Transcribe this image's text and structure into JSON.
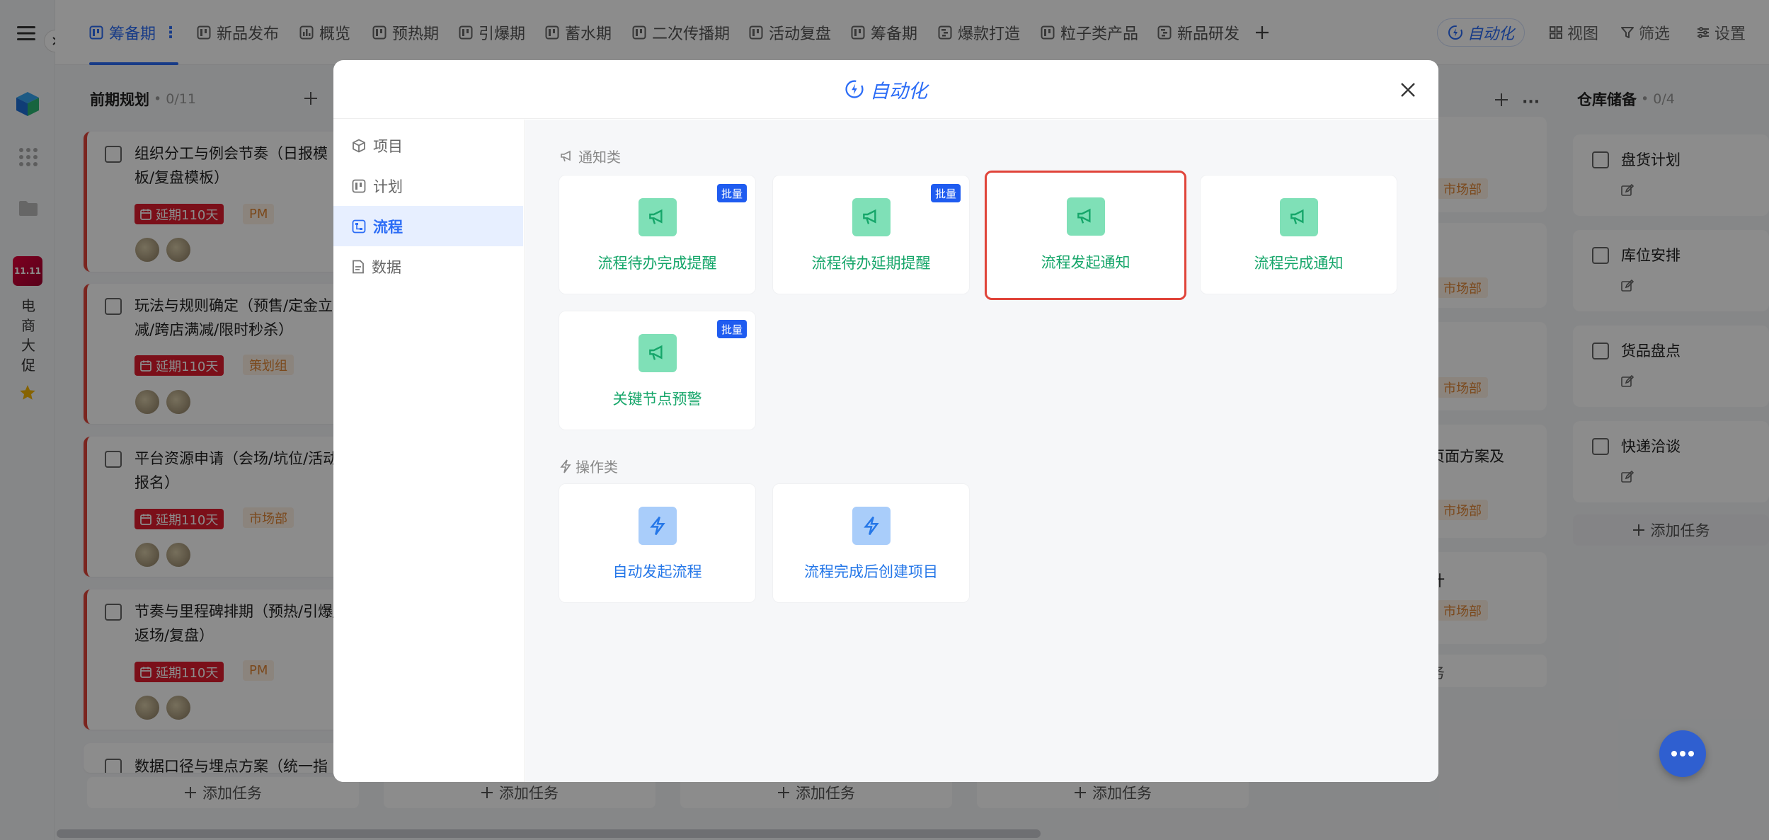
{
  "nav_tabs": [
    {
      "label": "筹备期",
      "active": true
    },
    {
      "label": "新品发布"
    },
    {
      "label": "概览"
    },
    {
      "label": "预热期"
    },
    {
      "label": "引爆期"
    },
    {
      "label": "蓄水期"
    },
    {
      "label": "二次传播期"
    },
    {
      "label": "活动复盘"
    },
    {
      "label": "筹备期"
    },
    {
      "label": "爆款打造"
    },
    {
      "label": "粒子类产品"
    },
    {
      "label": "新品研发"
    }
  ],
  "toolbar": {
    "automation": "自动化",
    "view": "视图",
    "filter": "筛选",
    "settings": "设置"
  },
  "project": {
    "name_chars": [
      "电",
      "商",
      "大",
      "促"
    ],
    "logo_text": "11.11"
  },
  "board": {
    "col1": {
      "title": "前期规划",
      "count": "• 0/11",
      "cards": [
        {
          "title": "组织分工与例会节奏（日报模板/复盘模板）",
          "delay": "延期110天",
          "tag": "PM"
        },
        {
          "title": "玩法与规则确定（预售/定金立减/跨店满减/限时秒杀）",
          "delay": "延期110天",
          "tag": "策划组"
        },
        {
          "title": "平台资源申请（会场/坑位/活动报名）",
          "delay": "延期110天",
          "tag": "市场部"
        },
        {
          "title": "节奏与里程碑排期（预热/引爆/返场/复盘）",
          "delay": "延期110天",
          "tag": "PM"
        },
        {
          "title": "数据口径与埋点方案（统一指"
        }
      ]
    },
    "add_task": "添加任务",
    "right_tags": [
      "市场部",
      "市场部",
      "市场部",
      "市场部",
      "市场部"
    ],
    "right_partial": [
      "页面方案及",
      "计",
      "务"
    ],
    "warehouse": {
      "title": "仓库储备",
      "count": "• 0/4",
      "items": [
        "盘货计划",
        "库位安排",
        "货品盘点",
        "快递洽谈"
      ]
    }
  },
  "modal": {
    "title": "自动化",
    "sidebar": [
      {
        "label": "项目",
        "icon": "cube-icon"
      },
      {
        "label": "计划",
        "icon": "board-icon"
      },
      {
        "label": "流程",
        "icon": "flow-icon",
        "active": true
      },
      {
        "label": "数据",
        "icon": "document-icon"
      }
    ],
    "notify_section": "通知类",
    "notify_items": [
      {
        "label": "流程待办完成提醒",
        "badge": "批量"
      },
      {
        "label": "流程待办延期提醒",
        "badge": "批量"
      },
      {
        "label": "流程发起通知",
        "selected": true
      },
      {
        "label": "流程完成通知"
      },
      {
        "label": "关键节点预警",
        "badge": "批量"
      }
    ],
    "action_section": "操作类",
    "action_items": [
      {
        "label": "自动发起流程"
      },
      {
        "label": "流程完成后创建项目"
      }
    ]
  },
  "colors": {
    "accent": "#2b6cf6",
    "notify": "#16a66a",
    "action": "#2577e8",
    "selected_border": "#e0443a",
    "delay_badge": "#e11d2e"
  }
}
